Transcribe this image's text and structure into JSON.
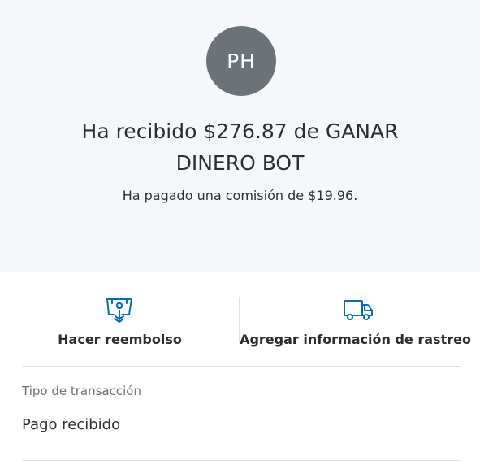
{
  "header": {
    "avatar_initials": "PH",
    "headline_line1": "Ha recibido $276.87 de GANAR",
    "headline_line2": "DINERO BOT",
    "fee_text": "Ha pagado una comisión de $19.96."
  },
  "actions": [
    {
      "label": "Hacer reembolso",
      "icon": "refund-icon"
    },
    {
      "label": "Agregar información de rastreo",
      "icon": "delivery-truck-icon"
    }
  ],
  "details": {
    "transaction_type_label": "Tipo de transacción",
    "transaction_type_value": "Pago recibido"
  },
  "colors": {
    "header_background": "#f5f7fa",
    "avatar_background": "#6c7378",
    "icon_blue": "#0070ba",
    "text_primary": "#2c2e2f",
    "text_secondary": "#6c7378",
    "divider": "#dfe3e6"
  }
}
